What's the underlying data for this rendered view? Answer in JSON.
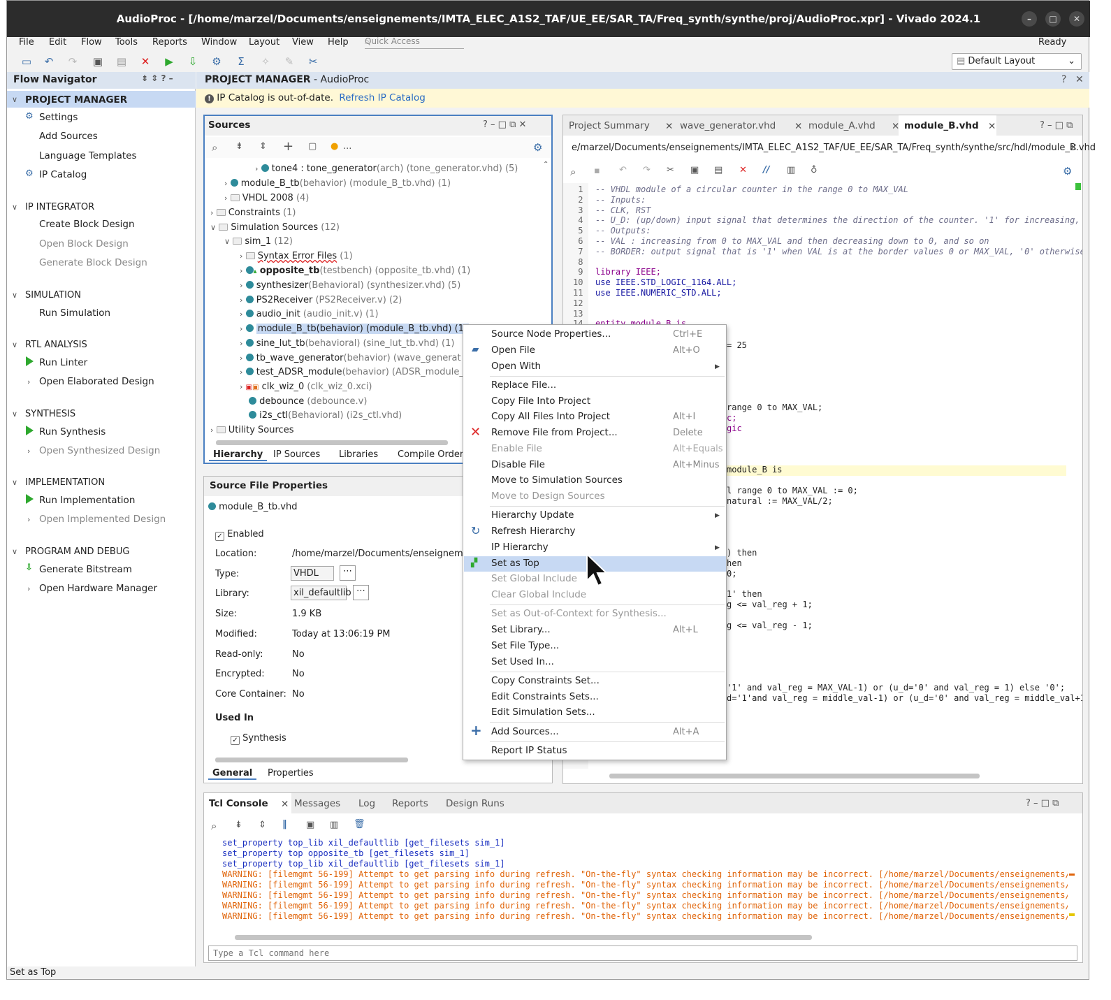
{
  "window": {
    "title": "AudioProc - [/home/marzel/Documents/enseignements/IMTA_ELEC_A1S2_TAF/UE_EE/SAR_TA/Freq_synth/synthe/proj/AudioProc.xpr] - Vivado 2024.1",
    "min": "–",
    "max": "□",
    "close": "✕"
  },
  "menu": {
    "file": "File",
    "edit": "Edit",
    "flow": "Flow",
    "tools": "Tools",
    "reports": "Reports",
    "window": "Window",
    "layout": "Layout",
    "view": "View",
    "help": "Help",
    "quick_access": "Quick Access",
    "status": "Ready",
    "layout_select": "Default Layout"
  },
  "nav": {
    "header": "Flow Navigator",
    "pm": "PROJECT MANAGER",
    "settings": "Settings",
    "add_sources": "Add Sources",
    "lang_templates": "Language Templates",
    "ip_catalog": "IP Catalog",
    "ipi": "IP INTEGRATOR",
    "create_bd": "Create Block Design",
    "open_bd": "Open Block Design",
    "gen_bd": "Generate Block Design",
    "sim": "SIMULATION",
    "run_sim": "Run Simulation",
    "rtl": "RTL ANALYSIS",
    "run_linter": "Run Linter",
    "open_elab": "Open Elaborated Design",
    "synth": "SYNTHESIS",
    "run_synth": "Run Synthesis",
    "open_synth": "Open Synthesized Design",
    "impl": "IMPLEMENTATION",
    "run_impl": "Run Implementation",
    "open_impl": "Open Implemented Design",
    "pd": "PROGRAM AND DEBUG",
    "gen_bit": "Generate Bitstream",
    "open_hw": "Open Hardware Manager"
  },
  "pm": {
    "header_bold": "PROJECT MANAGER",
    "header_rest": "- AudioProc",
    "banner": "IP Catalog is out-of-date.",
    "banner_link": "Refresh IP Catalog"
  },
  "sources": {
    "title": "Sources",
    "more": "...",
    "tree": [
      {
        "name": "tone4 : tone_generator",
        "rest": "(arch) (tone_generator.vhd) (5)"
      },
      {
        "name": "module_B_tb",
        "rest": "(behavior) (module_B_tb.vhd) (1)"
      },
      {
        "name": "VHDL 2008",
        "rest": "(4)"
      },
      {
        "name": "Constraints",
        "rest": "(1)"
      },
      {
        "name": "Simulation Sources",
        "rest": "(12)"
      },
      {
        "name": "sim_1",
        "rest": "(12)"
      },
      {
        "name": "Syntax Error Files",
        "rest": "(1)"
      },
      {
        "name": "opposite_tb",
        "rest": "(testbench) (opposite_tb.vhd) (1)"
      },
      {
        "name": "synthesizer",
        "rest": "(Behavioral) (synthesizer.vhd) (5)"
      },
      {
        "name": "PS2Receiver",
        "rest": "(PS2Receiver.v) (2)"
      },
      {
        "name": "audio_init",
        "rest": "(audio_init.v) (1)"
      },
      {
        "name": "module_B_tb(behavior) (module_B_tb.vhd) (1)",
        "rest": ""
      },
      {
        "name": "sine_lut_tb",
        "rest": "(behavioral) (sine_lut_tb.vhd) (1)"
      },
      {
        "name": "tb_wave_generator",
        "rest": "(behavior) (wave_generat"
      },
      {
        "name": "test_ADSR_module",
        "rest": "(behavior) (ADSR_module_t"
      },
      {
        "name": "clk_wiz_0",
        "rest": "(clk_wiz_0.xci)"
      },
      {
        "name": "debounce",
        "rest": "(debounce.v)"
      },
      {
        "name": "i2s_ctl",
        "rest": "(Behavioral) (i2s_ctl.vhd)"
      },
      {
        "name": "Utility Sources",
        "rest": ""
      }
    ],
    "tabs": [
      "Hierarchy",
      "IP Sources",
      "Libraries",
      "Compile Order"
    ]
  },
  "sfp": {
    "title": "Source File Properties",
    "file": "module_B_tb.vhd",
    "enabled": "Enabled",
    "location_l": "Location:",
    "location_v": "/home/marzel/Documents/enseigneme",
    "type_l": "Type:",
    "type_v": "VHDL",
    "library_l": "Library:",
    "library_v": "xil_defaultlib",
    "size_l": "Size:",
    "size_v": "1.9 KB",
    "modified_l": "Modified:",
    "modified_v": "Today at 13:06:19 PM",
    "readonly_l": "Read-only:",
    "readonly_v": "No",
    "encrypted_l": "Encrypted:",
    "encrypted_v": "No",
    "core_l": "Core Container:",
    "core_v": "No",
    "used_in": "Used In",
    "synthesis": "Synthesis",
    "tabs": [
      "General",
      "Properties"
    ]
  },
  "editor": {
    "tabs": [
      "Project Summary",
      "wave_generator.vhd",
      "module_A.vhd",
      "module_B.vhd"
    ],
    "path": "e/marzel/Documents/enseignements/IMTA_ELEC_A1S2_TAF/UE_EE/SAR_TA/Freq_synth/synthe/src/hdl/module_B.vhd",
    "lines": [
      "-- VHDL module of a circular counter in the range 0 to MAX_VAL",
      "-- Inputs:",
      "-- CLK, RST",
      "-- U_D: (up/down) input signal that determines the direction of the counter. '1' for increasing,",
      "-- Outputs:",
      "-- VAL : increasing from 0 to MAX_VAL and then decreasing down to 0, and so on",
      "-- BORDER: output signal that is '1' when VAL is at the border values 0 or MAX_VAL, '0' otherwise",
      "",
      "library IEEE;",
      "use IEEE.STD_LOGIC_1164.ALL;",
      "use IEEE.NUMERIC_STD.ALL;",
      "",
      "",
      "entity module_B is"
    ],
    "frag": [
      "= 25",
      "range 0 to MAX_VAL;",
      "c;",
      "gic",
      "module_B is",
      "l range 0 to MAX_VAL := 0;",
      "natural := MAX_VAL/2;",
      ") then",
      "hen",
      "0;",
      "1' then",
      "g <= val_reg + 1;",
      "g <= val_reg - 1;",
      "'1' and val_reg = MAX_VAL-1) or (u_d='0' and val_reg = 1) else '0';",
      "d='1'and val_reg = middle_val-1) or (u_d='0' and val_reg = middle_val+1"
    ]
  },
  "context_menu": [
    {
      "label": "Source Node Properties...",
      "shortcut": "Ctrl+E"
    },
    {
      "label": "Open File",
      "shortcut": "Alt+O"
    },
    {
      "label": "Open With",
      "shortcut": ""
    },
    {
      "label": "Replace File...",
      "shortcut": ""
    },
    {
      "label": "Copy File Into Project",
      "shortcut": ""
    },
    {
      "label": "Copy All Files Into Project",
      "shortcut": "Alt+I"
    },
    {
      "label": "Remove File from Project...",
      "shortcut": "Delete"
    },
    {
      "label": "Enable File",
      "shortcut": "Alt+Equals"
    },
    {
      "label": "Disable File",
      "shortcut": "Alt+Minus"
    },
    {
      "label": "Move to Simulation Sources",
      "shortcut": ""
    },
    {
      "label": "Move to Design Sources",
      "shortcut": ""
    },
    {
      "label": "Hierarchy Update",
      "shortcut": ""
    },
    {
      "label": "Refresh Hierarchy",
      "shortcut": ""
    },
    {
      "label": "IP Hierarchy",
      "shortcut": ""
    },
    {
      "label": "Set as Top",
      "shortcut": ""
    },
    {
      "label": "Set Global Include",
      "shortcut": ""
    },
    {
      "label": "Clear Global Include",
      "shortcut": ""
    },
    {
      "label": "Set as Out-of-Context for Synthesis...",
      "shortcut": ""
    },
    {
      "label": "Set Library...",
      "shortcut": "Alt+L"
    },
    {
      "label": "Set File Type...",
      "shortcut": ""
    },
    {
      "label": "Set Used In...",
      "shortcut": ""
    },
    {
      "label": "Copy Constraints Set...",
      "shortcut": ""
    },
    {
      "label": "Edit Constraints Sets...",
      "shortcut": ""
    },
    {
      "label": "Edit Simulation Sets...",
      "shortcut": ""
    },
    {
      "label": "Add Sources...",
      "shortcut": "Alt+A"
    },
    {
      "label": "Report IP Status",
      "shortcut": ""
    }
  ],
  "console": {
    "tabs": [
      "Tcl Console",
      "Messages",
      "Log",
      "Reports",
      "Design Runs"
    ],
    "lines": [
      "set_property top_lib xil_defaultlib [get_filesets sim_1]",
      "set_property top opposite_tb [get_filesets sim_1]",
      "set_property top_lib xil_defaultlib [get_filesets sim_1]",
      "WARNING: [filemgmt 56-199] Attempt to get parsing info during refresh. \"On-the-fly\" syntax checking information may be incorrect. [/home/marzel/Documents/enseignements/IMTA_EL",
      "WARNING: [filemgmt 56-199] Attempt to get parsing info during refresh. \"On-the-fly\" syntax checking information may be incorrect. [/home/marzel/Documents/enseignements/IMTA_EL",
      "WARNING: [filemgmt 56-199] Attempt to get parsing info during refresh. \"On-the-fly\" syntax checking information may be incorrect. [/home/marzel/Documents/enseignements/IMTA_EL",
      "WARNING: [filemgmt 56-199] Attempt to get parsing info during refresh. \"On-the-fly\" syntax checking information may be incorrect. [/home/marzel/Documents/enseignements/IMTA_EL",
      "WARNING: [filemgmt 56-199] Attempt to get parsing info during refresh. \"On-the-fly\" syntax checking information may be incorrect. [/home/marzel/Documents/enseignements/IMTA_EL"
    ],
    "placeholder": "Type a Tcl command here"
  },
  "statusbar": "Set as Top",
  "icons": {
    "search": "search-icon",
    "gear": "gear-icon",
    "close": "close-icon"
  },
  "colors": {
    "accent": "#4a7fc1",
    "highlight": "#c7d9f3",
    "warning": "#e0650b",
    "green": "#2ea82e"
  }
}
